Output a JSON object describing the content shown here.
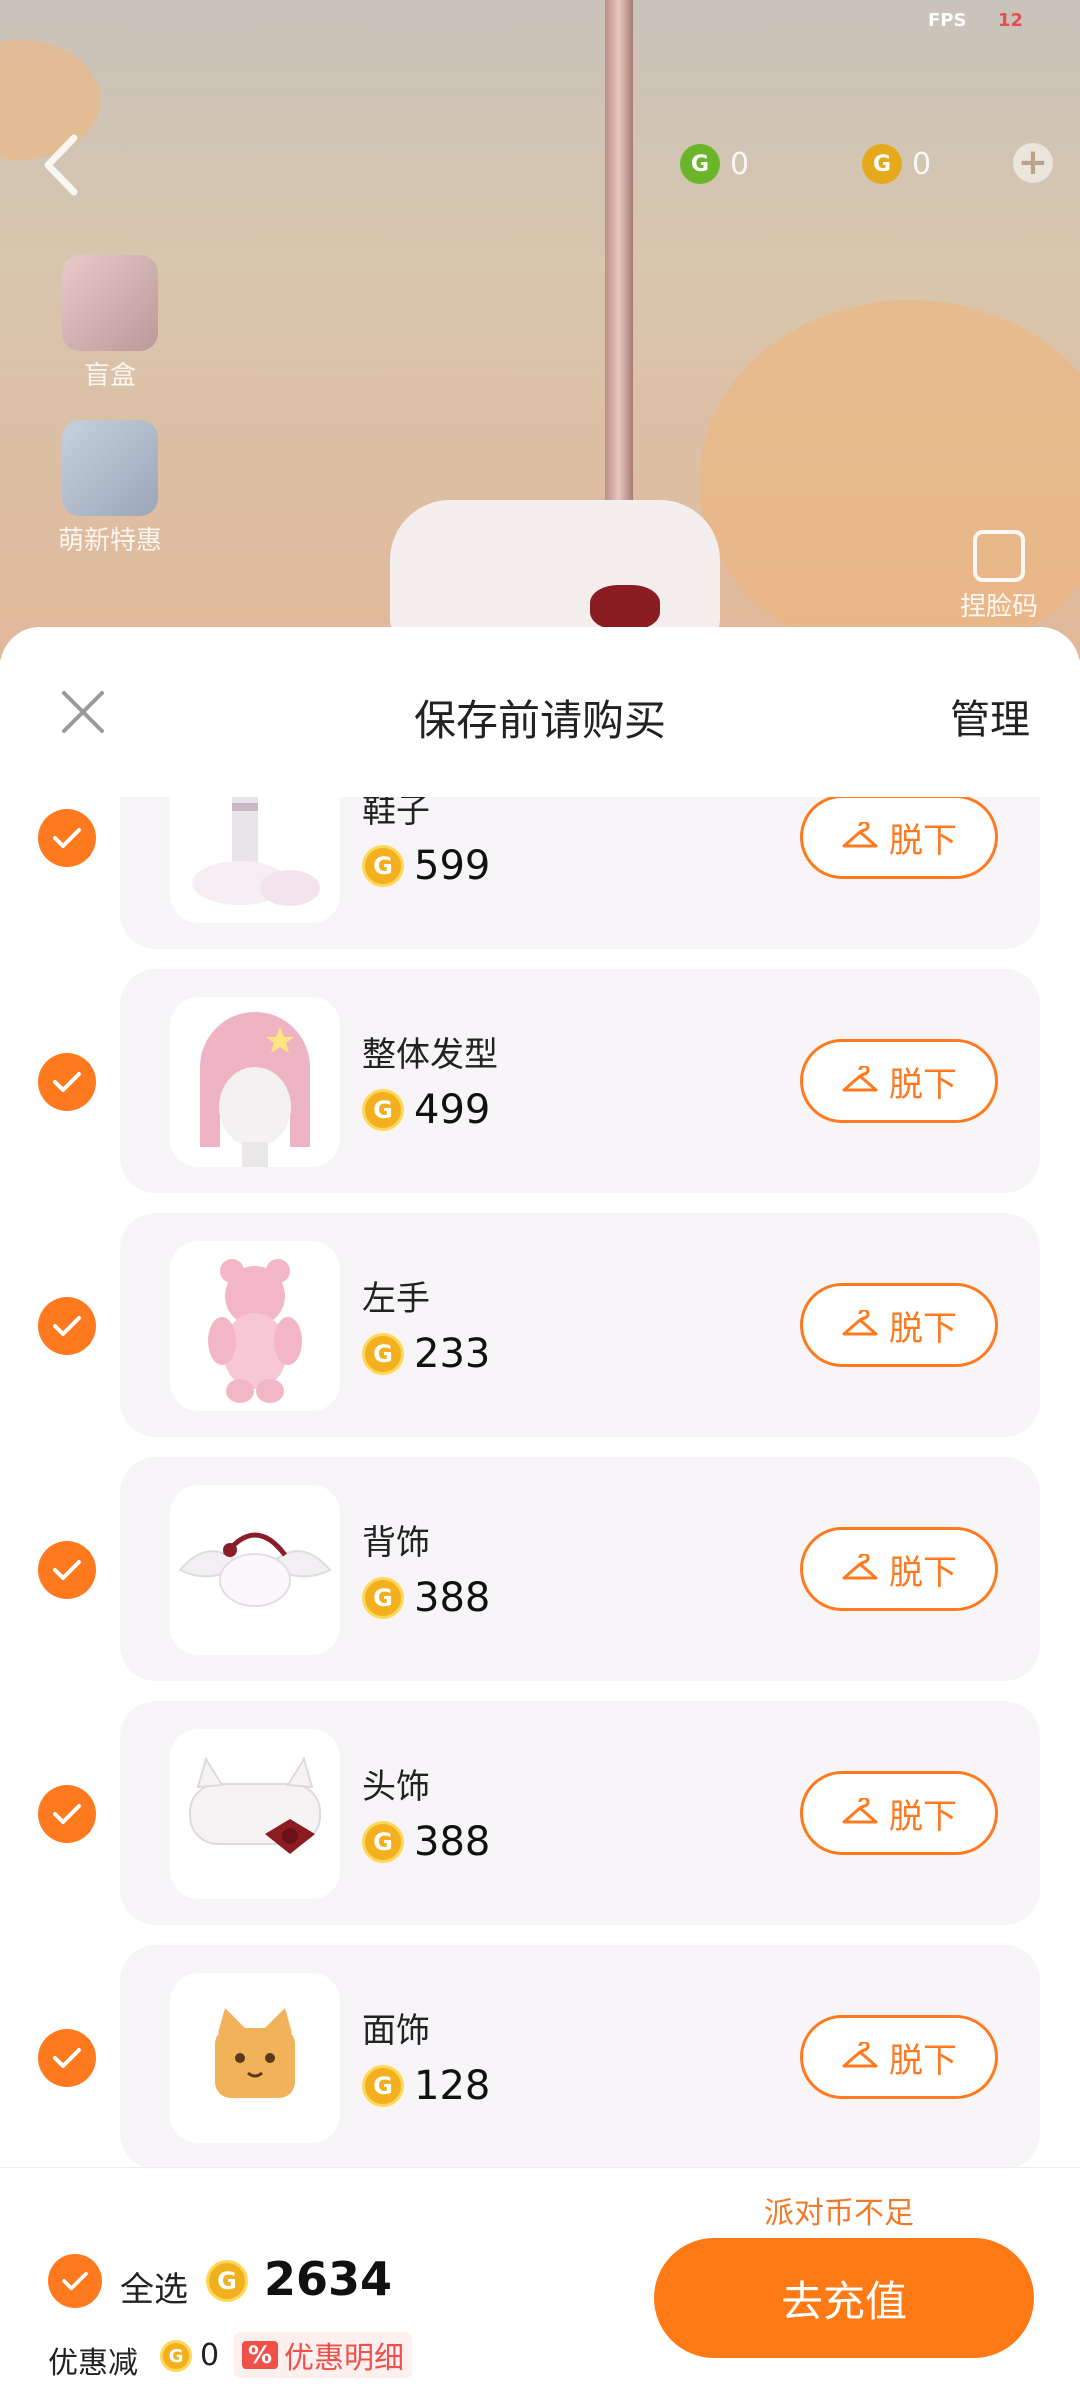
{
  "status": {
    "fps_label": "FPS",
    "fps_value": "12"
  },
  "topbar": {
    "currencies": [
      {
        "icon": "green-g-coin-icon",
        "value": "0",
        "color": "#6bb52a"
      },
      {
        "icon": "gold-g-coin-icon",
        "value": "0",
        "color": "#e6a91c"
      }
    ]
  },
  "side_menu": [
    {
      "label": "盲盒",
      "icon": "gift-box-icon"
    },
    {
      "label": "萌新特惠",
      "icon": "newbie-deal-icon"
    }
  ],
  "face_code": {
    "label": "捏脸码",
    "icon": "edit-icon"
  },
  "sheet": {
    "title": "保存前请购买",
    "manage_label": "管理",
    "takeoff_label": "脱下",
    "items": [
      {
        "name": "鞋子",
        "price": "599",
        "thumb": "shoes"
      },
      {
        "name": "整体发型",
        "price": "499",
        "thumb": "hair"
      },
      {
        "name": "左手",
        "price": "233",
        "thumb": "bear"
      },
      {
        "name": "背饰",
        "price": "388",
        "thumb": "wings"
      },
      {
        "name": "头饰",
        "price": "388",
        "thumb": "headband"
      },
      {
        "name": "面饰",
        "price": "128",
        "thumb": "cat-mask"
      }
    ]
  },
  "footer": {
    "insufficient": "派对币不足",
    "select_all": "全选",
    "total": "2634",
    "discount_label": "优惠减",
    "discount_value": "0",
    "discount_badge": "%",
    "discount_detail": "优惠明细",
    "recharge": "去充值"
  },
  "colors": {
    "accent": "#ff7a1f",
    "coin": "#f2b01e",
    "discount": "#f0504a"
  }
}
